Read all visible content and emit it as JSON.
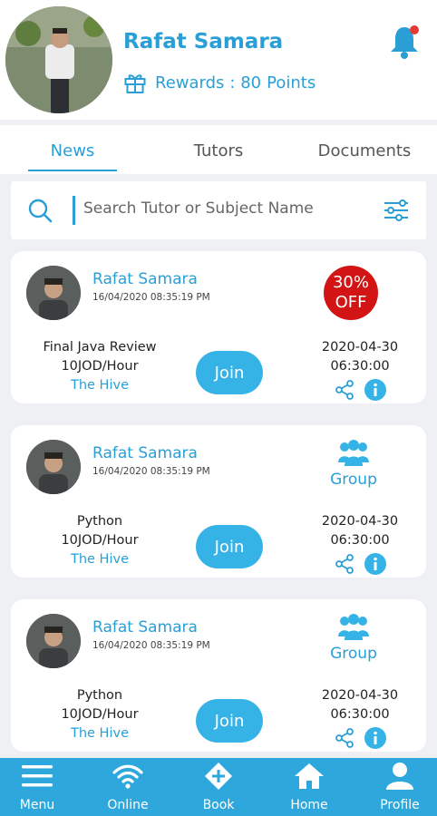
{
  "profile": {
    "name": "Rafat Samara",
    "rewards_label": "Rewards",
    "rewards_value": ": 80",
    "rewards_unit": "Points"
  },
  "tabs": [
    {
      "label": "News",
      "active": true
    },
    {
      "label": "Tutors",
      "active": false
    },
    {
      "label": "Documents",
      "active": false
    }
  ],
  "search": {
    "placeholder": "Search Tutor or Subject Name"
  },
  "cards": [
    {
      "tutor": "Rafat Samara",
      "posted": "16/04/2020 08:35:19 PM",
      "subject": "Final Java Review",
      "price": "10JOD/Hour",
      "venue": "The Hive",
      "join_label": "Join",
      "date": "2020-04-30",
      "time": "06:30:00",
      "badge": {
        "line1": "30%",
        "line2": "OFF"
      }
    },
    {
      "tutor": "Rafat Samara",
      "posted": "16/04/2020 08:35:19 PM",
      "subject": "Python",
      "price": "10JOD/Hour",
      "venue": "The Hive",
      "join_label": "Join",
      "date": "2020-04-30",
      "time": "06:30:00",
      "group_label": "Group"
    },
    {
      "tutor": "Rafat Samara",
      "posted": "16/04/2020 08:35:19 PM",
      "subject": "Python",
      "price": "10JOD/Hour",
      "venue": "The Hive",
      "join_label": "Join",
      "date": "2020-04-30",
      "time": "06:30:00",
      "group_label": "Group"
    }
  ],
  "nav": [
    {
      "label": "Menu",
      "icon": "menu-icon"
    },
    {
      "label": "Online",
      "icon": "wifi-icon"
    },
    {
      "label": "Book",
      "icon": "book-icon"
    },
    {
      "label": "Home",
      "icon": "home-icon"
    },
    {
      "label": "Profile",
      "icon": "profile-icon"
    }
  ],
  "colors": {
    "accent": "#2a9fd6",
    "join_button": "#35b3e6",
    "nav_bar": "#2ea8dc",
    "discount_badge": "#d21414",
    "notification_dot": "#e53935"
  }
}
